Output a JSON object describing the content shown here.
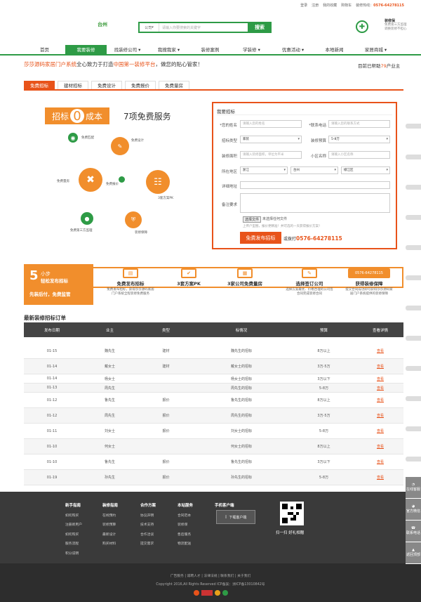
{
  "topbar": {
    "login": "登录",
    "register": "注册",
    "favorites": "我的收藏",
    "cart": "购物车",
    "hotline_label": "装修热线：",
    "hotline": "0576-64278115"
  },
  "header": {
    "city": "台州",
    "search_type": "公司",
    "search_placeholder": "请输入你要搜索的关键字",
    "search_button": "搜索",
    "guarantee_title": "装修保",
    "guarantee_line1": "免费第三方监理",
    "guarantee_line2": "调换装修不担心"
  },
  "nav": {
    "items": [
      "首页",
      "我要装修",
      "找装修公司",
      "我搜我家",
      "装修案例",
      "学装修",
      "优惠活动",
      "本地新闻",
      "家居商城"
    ]
  },
  "slogan": {
    "brand": "莎莎源码家居门户系统",
    "mid": "全心致力于打造",
    "highlight": "中国第一装修平台",
    "tail": "，做您的贴心管家！",
    "helped_prefix": "目前已帮助",
    "helped_num": "79",
    "helped_suffix": "户业主"
  },
  "tabs": [
    "免费招标",
    "建材招标",
    "免费设计",
    "免费报价",
    "免费量房"
  ],
  "promo": {
    "zb": "招标",
    "zero": "0",
    "cost": "成本",
    "services": "7项免费服务",
    "items": [
      "免费匹配",
      "免费设计",
      "免费量房",
      "免费报价",
      "3套方案PK",
      "免费第三方监理",
      "装修保障"
    ]
  },
  "form": {
    "title": "我要招标",
    "name_label": "*您的姓名",
    "name_ph": "请输入您的姓名",
    "phone_label": "*联系电话",
    "phone_ph": "请输入您的联系方式",
    "type_label": "招标类型",
    "type_val": "家装",
    "budget_label": "装修预算",
    "budget_val": "5-8万",
    "area_label": "装修面积",
    "area_ph": "请输入装修面积，单位为平米",
    "community_label": "小区名称",
    "community_ph": "请输入小区名称",
    "region_label": "所在地区",
    "province": "浙江",
    "city": "台州",
    "district": "椒江区",
    "address_label": "详细地址",
    "remark_label": "备注要求",
    "upload_btn": "选择文件",
    "upload_txt": "未选择任何文件",
    "upload_tip": "上传户型图，报价更精准！并可选的一天获得报价方案！",
    "submit": "免费发布招标",
    "call_prefix": "或拨打",
    "call_num": "0576-64278115"
  },
  "steps": {
    "num": "5",
    "unit": "小步",
    "line1": "轻松发布招标",
    "line2": "先装后付，免费监管",
    "items": [
      {
        "title": "免费发布招标",
        "desc": "免费发布招标，获得莎莎源码家居门户系统全程装修免费服务"
      },
      {
        "title": "3套方案PK",
        "desc": ""
      },
      {
        "title": "3家公司免费量房",
        "desc": ""
      },
      {
        "title": "选择签订公司",
        "desc": "选择方案最优、价格合理的公司签合同完成装修合同"
      },
      {
        "title": "获得装修保障",
        "desc": "提交合同成功即可获得莎莎源码家居门户系统提供的装修保障"
      }
    ],
    "phone": "0576-64278115"
  },
  "orders": {
    "title": "最新装修招标订单",
    "headers": [
      "发布日期",
      "业主",
      "类型",
      "标情况",
      "预算",
      "查看详情"
    ],
    "rows": [
      [
        "01-15",
        "魏先生",
        "建材",
        "魏先生的招标",
        "8万以上",
        "查看"
      ],
      [
        "01-14",
        "戴女士",
        "建材",
        "戴女士的招标",
        "3万-5万",
        "查看"
      ],
      [
        "01-14",
        "杨女士",
        "",
        "杨女士的招标",
        "3万以下",
        "查看"
      ],
      [
        "01-13",
        "周先生",
        "",
        "周先生的招标",
        "5-8万",
        "查看"
      ],
      [
        "01-12",
        "鲁先生",
        "报价",
        "鲁先生的招标",
        "8万以上",
        "查看"
      ],
      [
        "01-12",
        "周先生",
        "报价",
        "周先生的招标",
        "3万-5万",
        "查看"
      ],
      [
        "01-11",
        "刘女士",
        "报价",
        "刘女士的招标",
        "5-8万",
        "查看"
      ],
      [
        "01-10",
        "何女士",
        "",
        "何女士的招标",
        "8万以上",
        "查看"
      ],
      [
        "01-10",
        "鲁先生",
        "报价",
        "鲁先生的招标",
        "3万以下",
        "查看"
      ],
      [
        "01-19",
        "孙先生",
        "报价",
        "孙先生的招标",
        "5-8万",
        "查看"
      ]
    ]
  },
  "footer": {
    "cols": [
      {
        "title": "新手指南",
        "links": [
          "如何购买",
          "注册新用户",
          "如何购买",
          "服务流程",
          "积分说明"
        ]
      },
      {
        "title": "装修指南",
        "links": [
          "在线预约",
          "装修预算",
          "最新设计",
          "购买材料"
        ]
      },
      {
        "title": "合作方案",
        "links": [
          "协议声明",
          "技术支持",
          "合作洽谈",
          "提交需求"
        ]
      },
      {
        "title": "本站服务",
        "links": [
          "合同范本",
          "装修保",
          "售后服务",
          "物流配送"
        ]
      }
    ],
    "client_title": "手机客户端",
    "client_btn": "下载客户端",
    "qr_text": "扫一扫 好礼相赠",
    "bottom_links": "广告服务 | 诚聘人才 | 法律法规 | 联系我们 | 关于我们",
    "copyright": "Copyright 2016,All Rights Reserved ICP备案：浙ICP备13010842号"
  },
  "side": [
    "在线客服",
    "官方微信",
    "联系电话",
    "返回顶部"
  ]
}
